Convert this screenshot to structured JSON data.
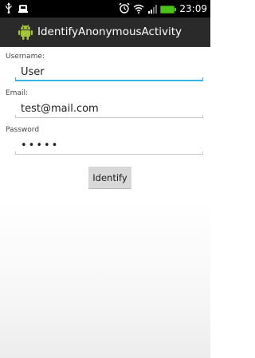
{
  "status_bar": {
    "time": "23:09",
    "icons": [
      "usb-icon",
      "notification-icon",
      "alarm-icon",
      "wifi-icon",
      "signal-icon",
      "battery-icon"
    ],
    "battery_color": "#4cc417"
  },
  "action_bar": {
    "title": "IdentifyAnonymousActivity",
    "icon": "android-icon",
    "icon_color": "#a4c639"
  },
  "form": {
    "username_label": "Username:",
    "username_value": "User",
    "email_label": "Email:",
    "email_value": "test@mail.com",
    "password_label": "Password",
    "password_value": "•••••",
    "identify_label": "Identify"
  },
  "colors": {
    "accent": "#33b5e5",
    "status_bar_bg": "#000000",
    "action_bar_bg": "#2a2a2a"
  }
}
